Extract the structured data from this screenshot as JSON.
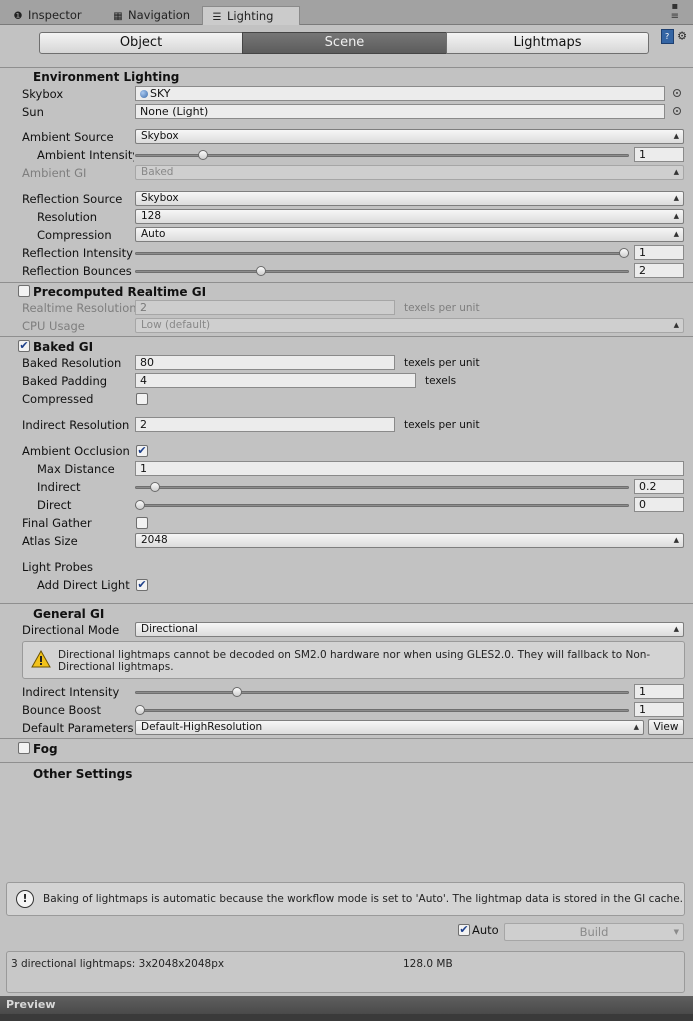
{
  "tabs": [
    {
      "label": "Inspector",
      "icon": "info-icon"
    },
    {
      "label": "Navigation",
      "icon": "navigation-icon"
    },
    {
      "label": "Lighting",
      "icon": "lighting-icon"
    }
  ],
  "toolbar": {
    "segments": [
      "Object",
      "Scene",
      "Lightmaps"
    ],
    "selected": "Scene"
  },
  "environment": {
    "title": "Environment Lighting",
    "skybox_label": "Skybox",
    "skybox_value": "SKY",
    "sun_label": "Sun",
    "sun_value": "None (Light)",
    "ambient_source_label": "Ambient Source",
    "ambient_source_value": "Skybox",
    "ambient_intensity_label": "Ambient Intensity",
    "ambient_intensity_value": "1",
    "ambient_intensity_level": 0.13,
    "ambient_gi_label": "Ambient GI",
    "ambient_gi_value": "Baked",
    "reflection_source_label": "Reflection Source",
    "reflection_source_value": "Skybox",
    "resolution_label": "Resolution",
    "resolution_value": "128",
    "compression_label": "Compression",
    "compression_value": "Auto",
    "reflection_intensity_label": "Reflection Intensity",
    "reflection_intensity_value": "1",
    "reflection_intensity_level": 1.0,
    "reflection_bounces_label": "Reflection Bounces",
    "reflection_bounces_value": "2",
    "reflection_bounces_level": 0.25
  },
  "precomputed": {
    "title": "Precomputed Realtime GI",
    "enabled": false,
    "realtime_resolution_label": "Realtime Resolution",
    "realtime_resolution_value": "2",
    "texels_label": "texels per unit",
    "cpu_usage_label": "CPU Usage",
    "cpu_usage_value": "Low (default)"
  },
  "baked": {
    "title": "Baked GI",
    "enabled": true,
    "baked_resolution_label": "Baked Resolution",
    "baked_resolution_value": "80",
    "baked_resolution_unit": "texels per unit",
    "baked_padding_label": "Baked Padding",
    "baked_padding_value": "4",
    "baked_padding_unit": "texels",
    "compressed_label": "Compressed",
    "compressed": false,
    "indirect_resolution_label": "Indirect Resolution",
    "indirect_resolution_value": "2",
    "indirect_resolution_unit": "texels per unit",
    "ambient_occlusion_label": "Ambient Occlusion",
    "ambient_occlusion": true,
    "max_distance_label": "Max Distance",
    "max_distance_value": "1",
    "indirect_label": "Indirect",
    "indirect_value": "0.2",
    "indirect_level": 0.02,
    "direct_label": "Direct",
    "direct_value": "0",
    "direct_level": 0.0,
    "final_gather_label": "Final Gather",
    "final_gather": false,
    "atlas_size_label": "Atlas Size",
    "atlas_size_value": "2048",
    "light_probes_label": "Light Probes",
    "add_direct_light_label": "Add Direct Light",
    "add_direct_light": true
  },
  "general": {
    "title": "General GI",
    "directional_mode_label": "Directional Mode",
    "directional_mode_value": "Directional",
    "warning": "Directional lightmaps cannot be decoded on SM2.0 hardware nor when using GLES2.0. They will fallback to Non-Directional lightmaps.",
    "indirect_intensity_label": "Indirect Intensity",
    "indirect_intensity_value": "1",
    "indirect_intensity_level": 0.2,
    "bounce_boost_label": "Bounce Boost",
    "bounce_boost_value": "1",
    "bounce_boost_level": 0.0,
    "default_parameters_label": "Default Parameters",
    "default_parameters_value": "Default-HighResolution",
    "view_button": "View"
  },
  "fog": {
    "label": "Fog",
    "enabled": false
  },
  "other_settings": {
    "title": "Other Settings"
  },
  "footer": {
    "info": "Baking of lightmaps is automatic because the workflow mode is set to 'Auto'. The lightmap data is stored in the GI cache.",
    "auto_label": "Auto",
    "auto": true,
    "build_label": "Build",
    "stats_left": "3 directional lightmaps: 3x2048x2048px",
    "stats_right": "128.0 MB"
  },
  "preview_label": "Preview"
}
